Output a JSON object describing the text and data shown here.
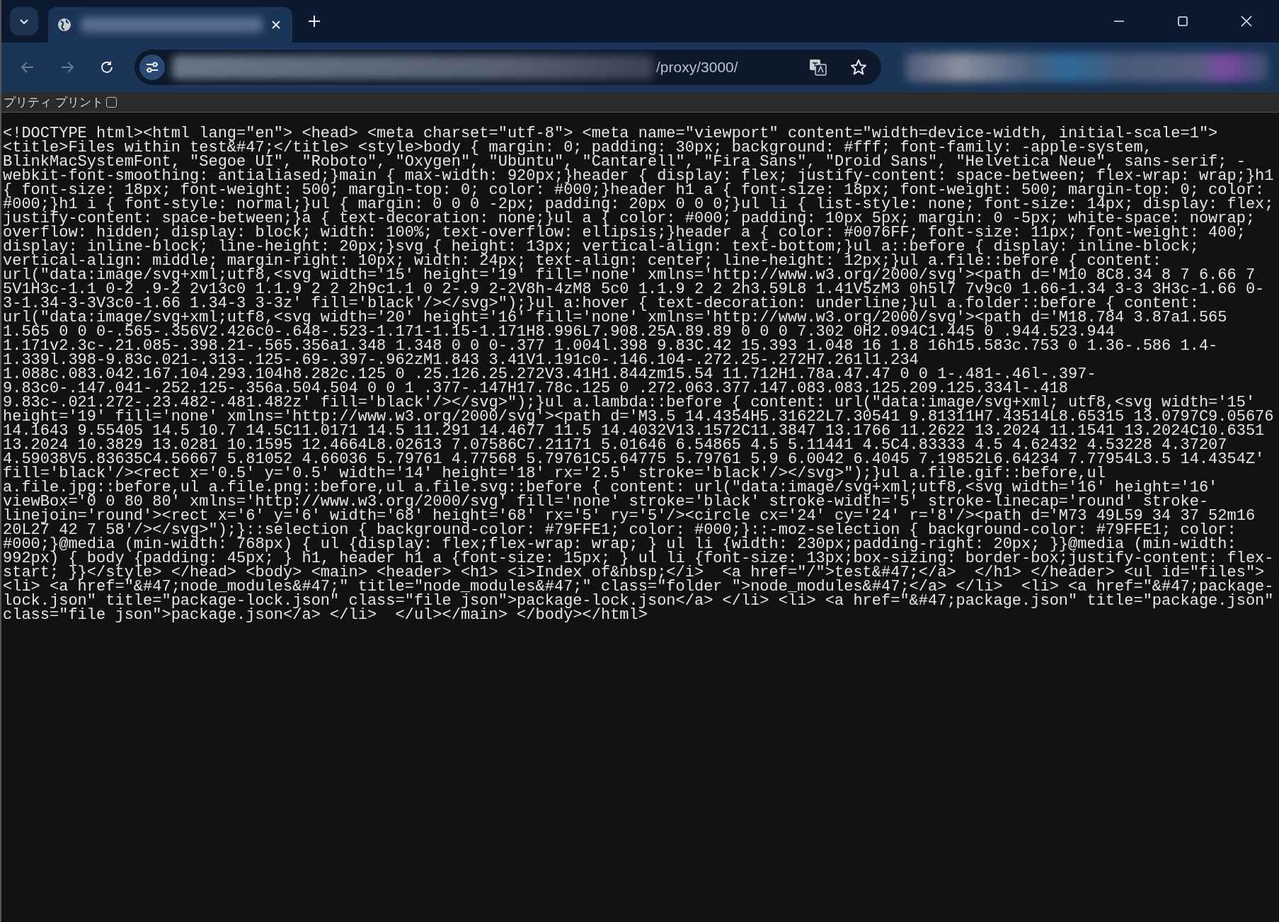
{
  "browser": {
    "address_bar": {
      "url_visible": "/proxy/3000/"
    }
  },
  "pretty_print": {
    "label": "プリティ プリント",
    "checked": false
  },
  "source": "<!DOCTYPE html><html lang=\"en\"> <head> <meta charset=\"utf-8\"> <meta name=\"viewport\" content=\"width=device-width, initial-scale=1\"> <title>Files within test&#47;</title> <style>body { margin: 0; padding: 30px; background: #fff; font-family: -apple-system, BlinkMacSystemFont, \"Segoe UI\", \"Roboto\", \"Oxygen\", \"Ubuntu\", \"Cantarell\", \"Fira Sans\", \"Droid Sans\", \"Helvetica Neue\", sans-serif; -webkit-font-smoothing: antialiased;}main { max-width: 920px;}header { display: flex; justify-content: space-between; flex-wrap: wrap;}h1 { font-size: 18px; font-weight: 500; margin-top: 0; color: #000;}header h1 a { font-size: 18px; font-weight: 500; margin-top: 0; color: #000;}h1 i { font-style: normal;}ul { margin: 0 0 0 -2px; padding: 20px 0 0 0;}ul li { list-style: none; font-size: 14px; display: flex; justify-content: space-between;}a { text-decoration: none;}ul a { color: #000; padding: 10px 5px; margin: 0 -5px; white-space: nowrap; overflow: hidden; display: block; width: 100%; text-overflow: ellipsis;}header a { color: #0076FF; font-size: 11px; font-weight: 400; display: inline-block; line-height: 20px;}svg { height: 13px; vertical-align: text-bottom;}ul a::before { display: inline-block; vertical-align: middle; margin-right: 10px; width: 24px; text-align: center; line-height: 12px;}ul a.file::before { content: url(\"data:image/svg+xml;utf8,<svg width='15' height='19' fill='none' xmlns='http://www.w3.org/2000/svg'><path d='M10 8C8.34 8 7 6.66 7 5V1H3c-1.1 0-2 .9-2 2v13c0 1.1.9 2 2 2h9c1.1 0 2-.9 2-2V8h-4zM8 5c0 1.1.9 2 2 2h3.59L8 1.41V5zM3 0h5l7 7v9c0 1.66-1.34 3-3 3H3c-1.66 0-3-1.34-3-3V3c0-1.66 1.34-3 3-3z' fill='black'/></svg>\");}ul a:hover { text-decoration: underline;}ul a.folder::before { content: url(\"data:image/svg+xml;utf8,<svg width='20' height='16' fill='none' xmlns='http://www.w3.org/2000/svg'><path d='M18.784 3.87a1.565 1.565 0 0 0-.565-.356V2.426c0-.648-.523-1.171-1.15-1.171H8.996L7.908.25A.89.89 0 0 0 7.302 0H2.094C1.445 0 .944.523.944 1.171v2.3c-.21.085-.398.21-.565.356a1.348 1.348 0 0 0-.377 1.004l.398 9.83C.42 15.393 1.048 16 1.8 16h15.583c.753 0 1.36-.586 1.4-1.339l.398-9.83c.021-.313-.125-.69-.397-.962zM1.843 3.41V1.191c0-.146.104-.272.25-.272H7.261l1.234 1.088c.083.042.167.104.293.104h8.282c.125 0 .25.126.25.272V3.41H1.844zm15.54 11.712H1.78a.47.47 0 0 1-.481-.46l-.397-9.83c0-.147.041-.252.125-.356a.504.504 0 0 1 .377-.147H17.78c.125 0 .272.063.377.147.083.083.125.209.125.334l-.418 9.83c-.021.272-.23.482-.481.482z' fill='black'/></svg>\");}ul a.lambda::before { content: url(\"data:image/svg+xml; utf8,<svg width='15' height='19' fill='none' xmlns='http://www.w3.org/2000/svg'><path d='M3.5 14.4354H5.31622L7.30541 9.81311H7.43514L8.65315 13.0797C9.05676 14.1643 9.55405 14.5 10.7 14.5C11.0171 14.5 11.291 14.4677 11.5 14.4032V13.1572C11.3847 13.1766 11.2622 13.2024 11.1541 13.2024C10.6351 13.2024 10.3829 13.0281 10.1595 12.4664L8.02613 7.07586C7.21171 5.01646 6.54865 4.5 5.11441 4.5C4.83333 4.5 4.62432 4.53228 4.37207 4.59038V5.83635C4.56667 5.81052 4.66036 5.79761 4.77568 5.79761C5.64775 5.79761 5.9 6.0042 6.4045 7.19852L6.64234 7.77954L3.5 14.4354Z' fill='black'/><rect x='0.5' y='0.5' width='14' height='18' rx='2.5' stroke='black'/></svg>\");}ul a.file.gif::before,ul a.file.jpg::before,ul a.file.png::before,ul a.file.svg::before { content: url(\"data:image/svg+xml;utf8,<svg width='16' height='16' viewBox='0 0 80 80' xmlns='http://www.w3.org/2000/svg' fill='none' stroke='black' stroke-width='5' stroke-linecap='round' stroke-linejoin='round'><rect x='6' y='6' width='68' height='68' rx='5' ry='5'/><circle cx='24' cy='24' r='8'/><path d='M73 49L59 34 37 52m16 20L27 42 7 58'/></svg>\");}::selection { background-color: #79FFE1; color: #000;}::-moz-selection { background-color: #79FFE1; color: #000;}@media (min-width: 768px) { ul {display: flex;flex-wrap: wrap; } ul li {width: 230px;padding-right: 20px; }}@media (min-width: 992px) { body {padding: 45px; } h1, header h1 a {font-size: 15px; } ul li {font-size: 13px;box-sizing: border-box;justify-content: flex-start; }}</style> </head> <body> <main> <header> <h1> <i>Index of&nbsp;</i>  <a href=\"/\">test&#47;</a>  </h1> </header> <ul id=\"files\">  <li> <a href=\"&#47;node_modules&#47;\" title=\"node_modules&#47;\" class=\"folder \">node_modules&#47;</a> </li>  <li> <a href=\"&#47;package-lock.json\" title=\"package-lock.json\" class=\"file json\">package-lock.json</a> </li> <li> <a href=\"&#47;package.json\" title=\"package.json\" class=\"file json\">package.json</a> </li>  </ul></main> </body></html>"
}
